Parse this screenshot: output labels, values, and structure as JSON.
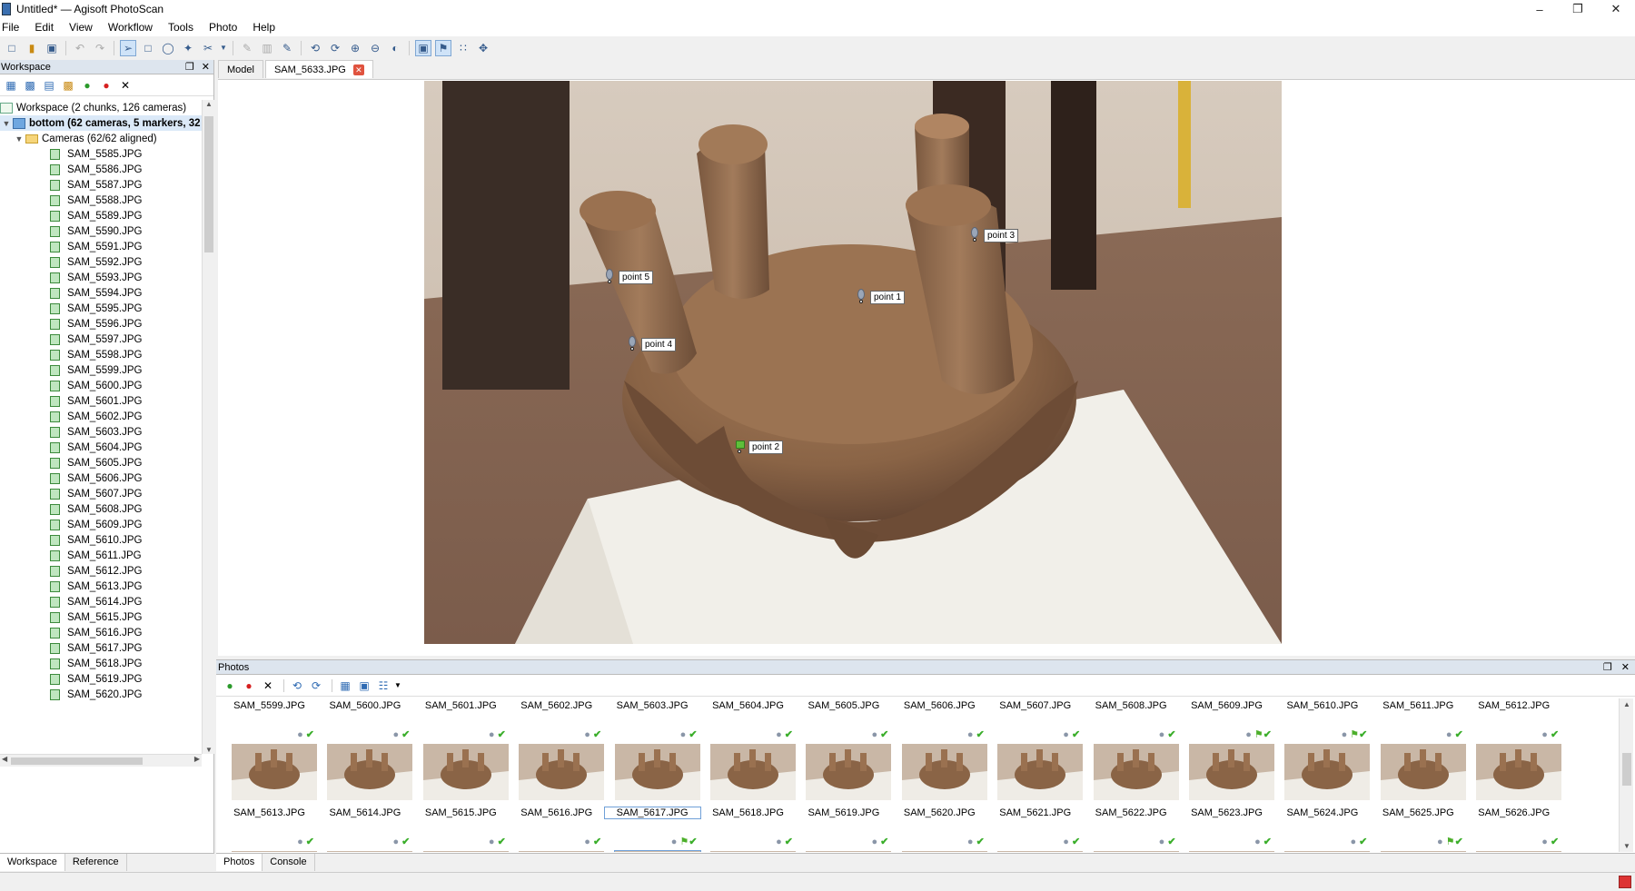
{
  "window": {
    "title": "Untitled* — Agisoft PhotoScan",
    "minimize": "–",
    "restore": "❐",
    "close": "✕"
  },
  "menu": [
    "File",
    "Edit",
    "View",
    "Workflow",
    "Tools",
    "Photo",
    "Help"
  ],
  "workspace": {
    "pane_title": "Workspace",
    "root_label": "Workspace (2 chunks, 126 cameras)",
    "chunk_label": "bottom (62 cameras, 5 markers, 32",
    "cameras_label": "Cameras (62/62 aligned)",
    "cameras": [
      "SAM_5585.JPG",
      "SAM_5586.JPG",
      "SAM_5587.JPG",
      "SAM_5588.JPG",
      "SAM_5589.JPG",
      "SAM_5590.JPG",
      "SAM_5591.JPG",
      "SAM_5592.JPG",
      "SAM_5593.JPG",
      "SAM_5594.JPG",
      "SAM_5595.JPG",
      "SAM_5596.JPG",
      "SAM_5597.JPG",
      "SAM_5598.JPG",
      "SAM_5599.JPG",
      "SAM_5600.JPG",
      "SAM_5601.JPG",
      "SAM_5602.JPG",
      "SAM_5603.JPG",
      "SAM_5604.JPG",
      "SAM_5605.JPG",
      "SAM_5606.JPG",
      "SAM_5607.JPG",
      "SAM_5608.JPG",
      "SAM_5609.JPG",
      "SAM_5610.JPG",
      "SAM_5611.JPG",
      "SAM_5612.JPG",
      "SAM_5613.JPG",
      "SAM_5614.JPG",
      "SAM_5615.JPG",
      "SAM_5616.JPG",
      "SAM_5617.JPG",
      "SAM_5618.JPG",
      "SAM_5619.JPG",
      "SAM_5620.JPG"
    ],
    "bottom_tabs": [
      "Workspace",
      "Reference"
    ]
  },
  "doc_tabs": [
    "Model",
    "SAM_5633.JPG"
  ],
  "markers": [
    {
      "label": "point 5",
      "type": "gray"
    },
    {
      "label": "point 1",
      "type": "gray"
    },
    {
      "label": "point 3",
      "type": "gray"
    },
    {
      "label": "point 4",
      "type": "gray"
    },
    {
      "label": "point 2",
      "type": "green"
    }
  ],
  "photos_pane": {
    "title": "Photos",
    "row1": [
      {
        "name": "SAM_5599.JPG",
        "flag": false
      },
      {
        "name": "SAM_5600.JPG",
        "flag": false
      },
      {
        "name": "SAM_5601.JPG",
        "flag": false
      },
      {
        "name": "SAM_5602.JPG",
        "flag": false
      },
      {
        "name": "SAM_5603.JPG",
        "flag": false
      },
      {
        "name": "SAM_5604.JPG",
        "flag": false
      },
      {
        "name": "SAM_5605.JPG",
        "flag": false
      },
      {
        "name": "SAM_5606.JPG",
        "flag": false
      },
      {
        "name": "SAM_5607.JPG",
        "flag": false
      },
      {
        "name": "SAM_5608.JPG",
        "flag": false
      },
      {
        "name": "SAM_5609.JPG",
        "flag": true
      },
      {
        "name": "SAM_5610.JPG",
        "flag": true
      },
      {
        "name": "SAM_5611.JPG",
        "flag": false
      },
      {
        "name": "SAM_5612.JPG",
        "flag": false
      }
    ],
    "row2": [
      {
        "name": "SAM_5613.JPG",
        "flag": false
      },
      {
        "name": "SAM_5614.JPG",
        "flag": false
      },
      {
        "name": "SAM_5615.JPG",
        "flag": false
      },
      {
        "name": "SAM_5616.JPG",
        "flag": false
      },
      {
        "name": "SAM_5617.JPG",
        "flag": true
      },
      {
        "name": "SAM_5618.JPG",
        "flag": false
      },
      {
        "name": "SAM_5619.JPG",
        "flag": false
      },
      {
        "name": "SAM_5620.JPG",
        "flag": false
      },
      {
        "name": "SAM_5621.JPG",
        "flag": false
      },
      {
        "name": "SAM_5622.JPG",
        "flag": false
      },
      {
        "name": "SAM_5623.JPG",
        "flag": false
      },
      {
        "name": "SAM_5624.JPG",
        "flag": false
      },
      {
        "name": "SAM_5625.JPG",
        "flag": true
      },
      {
        "name": "SAM_5626.JPG",
        "flag": false
      }
    ],
    "bottom_tabs": [
      "Photos",
      "Console"
    ]
  },
  "icons": {
    "workspace_tools": [
      "add-photos-icon",
      "add-chunk-icon",
      "add-folder-icon",
      "add-marker-icon",
      "enable-icon",
      "disable-icon",
      "remove-icon"
    ],
    "photos_tools": [
      "enable-icon",
      "disable-icon",
      "remove-icon",
      "rotate-left-icon",
      "rotate-right-icon",
      "view-mode-icon",
      "grid-icon",
      "columns-icon"
    ]
  },
  "colors": {
    "accent": "#3c6fa8",
    "check": "#3aae2a",
    "marker_green": "#5fbf3a",
    "close_tab": "#e0533f"
  }
}
